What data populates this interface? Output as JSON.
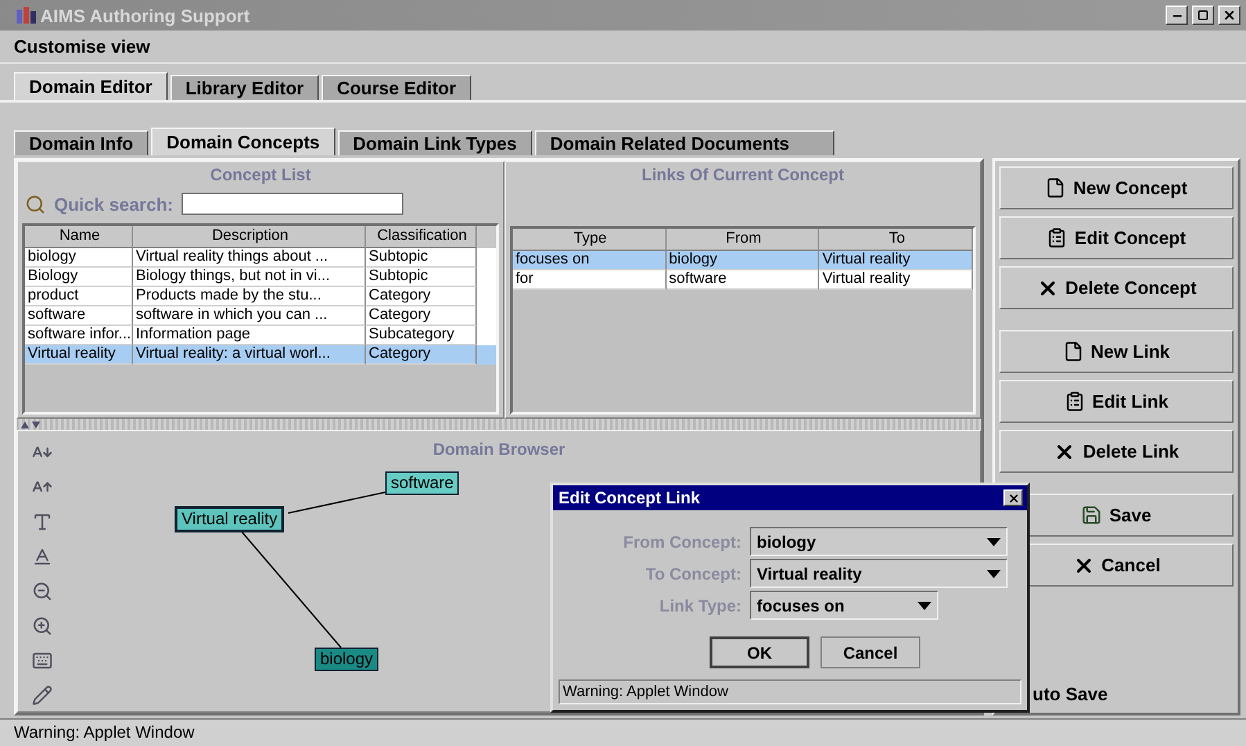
{
  "window": {
    "title": "AIMS Authoring Support"
  },
  "menu": [
    "Customise view"
  ],
  "editor_tabs": [
    {
      "label": "Domain Editor",
      "selected": true
    },
    {
      "label": "Library Editor",
      "selected": false
    },
    {
      "label": "Course Editor",
      "selected": false
    }
  ],
  "domain_tabs": [
    {
      "label": "Domain Info",
      "selected": false
    },
    {
      "label": "Domain Concepts",
      "selected": true
    },
    {
      "label": "Domain Link Types",
      "selected": false
    },
    {
      "label": "Domain Related Documents",
      "selected": false
    }
  ],
  "concept_list": {
    "title": "Concept List",
    "search": {
      "label": "Quick search:"
    },
    "columns": [
      "Name",
      "Description",
      "Classification"
    ],
    "rows": [
      {
        "cells": [
          "biology",
          "Virtual reality things about ...",
          "Subtopic"
        ],
        "selected": false
      },
      {
        "cells": [
          "Biology",
          "Biology things, but not in vi...",
          "Subtopic"
        ],
        "selected": false
      },
      {
        "cells": [
          "product",
          "Products made by the stu...",
          "Category"
        ],
        "selected": false
      },
      {
        "cells": [
          "software",
          "software in which you can ...",
          "Category"
        ],
        "selected": false
      },
      {
        "cells": [
          "software infor...",
          "Information page",
          "Subcategory"
        ],
        "selected": false
      },
      {
        "cells": [
          "Virtual reality",
          "Virtual reality: a virtual worl...",
          "Category"
        ],
        "selected": true
      }
    ]
  },
  "links": {
    "title": "Links Of Current Concept",
    "columns": [
      "Type",
      "From",
      "To"
    ],
    "rows": [
      {
        "cells": [
          "focuses on",
          "biology",
          "Virtual reality"
        ],
        "selected": true
      },
      {
        "cells": [
          "for",
          "software",
          "Virtual reality"
        ],
        "selected": false
      }
    ]
  },
  "domain_browser": {
    "title": "Domain Browser",
    "nodes": [
      {
        "label": "Virtual reality",
        "kind": "hub",
        "color": "#5cc4bc"
      },
      {
        "label": "software",
        "kind": "leaf",
        "color": "#66ccc4"
      },
      {
        "label": "biology",
        "kind": "leaf",
        "color": "#1a8a84"
      }
    ]
  },
  "button_groups": [
    {
      "buttons": [
        {
          "label": "New Concept",
          "kind": "new"
        },
        {
          "label": "Edit Concept",
          "kind": "edit"
        },
        {
          "label": "Delete Concept",
          "kind": "delete"
        }
      ]
    },
    {
      "buttons": [
        {
          "label": "New Link",
          "kind": "new"
        },
        {
          "label": "Edit Link",
          "kind": "edit"
        },
        {
          "label": "Delete Link",
          "kind": "delete"
        }
      ]
    },
    {
      "buttons": [
        {
          "label": "Save",
          "kind": "save"
        },
        {
          "label": "Cancel",
          "kind": "delete"
        }
      ]
    }
  ],
  "auto_save": "uto Save",
  "dialog": {
    "title": "Edit Concept Link",
    "fields": [
      {
        "label": "From Concept:",
        "value": "biology",
        "kind": "wide"
      },
      {
        "label": "To Concept:",
        "value": "Virtual reality",
        "kind": "wide"
      },
      {
        "label": "Link Type:",
        "value": "focuses on",
        "kind": "narrow"
      }
    ],
    "buttons": [
      {
        "label": "OK",
        "selected": true
      },
      {
        "label": "Cancel",
        "selected": false
      }
    ],
    "status": "Warning: Applet Window"
  },
  "status_bar": "Warning: Applet Window"
}
